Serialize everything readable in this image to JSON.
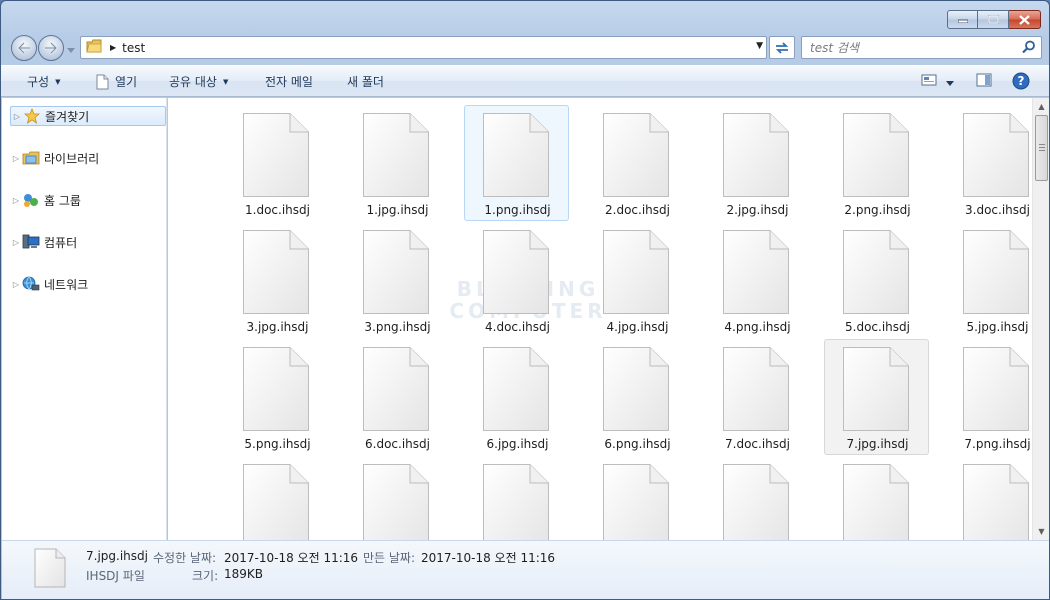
{
  "window": {
    "minimize_label": "minimize",
    "maximize_label": "maximize",
    "close_label": "close"
  },
  "address": {
    "path": "test"
  },
  "search": {
    "placeholder": "test 검색"
  },
  "toolbar": {
    "organize": "구성",
    "open": "열기",
    "share": "공유 대상",
    "email": "전자 메일",
    "new_folder": "새 폴더"
  },
  "nav_pane": {
    "items": [
      {
        "label": "즐겨찾기",
        "icon": "star-icon"
      },
      {
        "label": "라이브러리",
        "icon": "library-icon"
      },
      {
        "label": "홈 그룹",
        "icon": "homegroup-icon"
      },
      {
        "label": "컴퓨터",
        "icon": "computer-icon"
      },
      {
        "label": "네트워크",
        "icon": "network-icon"
      }
    ]
  },
  "watermark": {
    "line1": "BLEEPING",
    "line2": "COMPUTER"
  },
  "files": [
    "1.doc.ihsdj",
    "1.jpg.ihsdj",
    "1.png.ihsdj",
    "2.doc.ihsdj",
    "2.jpg.ihsdj",
    "2.png.ihsdj",
    "3.doc.ihsdj",
    "3.jpg.ihsdj",
    "3.png.ihsdj",
    "4.doc.ihsdj",
    "4.jpg.ihsdj",
    "4.png.ihsdj",
    "5.doc.ihsdj",
    "5.jpg.ihsdj",
    "5.png.ihsdj",
    "6.doc.ihsdj",
    "6.jpg.ihsdj",
    "6.png.ihsdj",
    "7.doc.ihsdj",
    "7.jpg.ihsdj",
    "7.png.ihsdj",
    "",
    "",
    "",
    "",
    "",
    "",
    ""
  ],
  "selected_file_index": 2,
  "hovered_file_index": 19,
  "details": {
    "name": "7.jpg.ihsdj",
    "type": "IHSDJ 파일",
    "modified_label": "수정한 날짜:",
    "modified_value": "2017-10-18 오전 11:16",
    "created_label": "만든 날짜:",
    "created_value": "2017-10-18 오전 11:16",
    "size_label": "크기:",
    "size_value": "189KB"
  }
}
